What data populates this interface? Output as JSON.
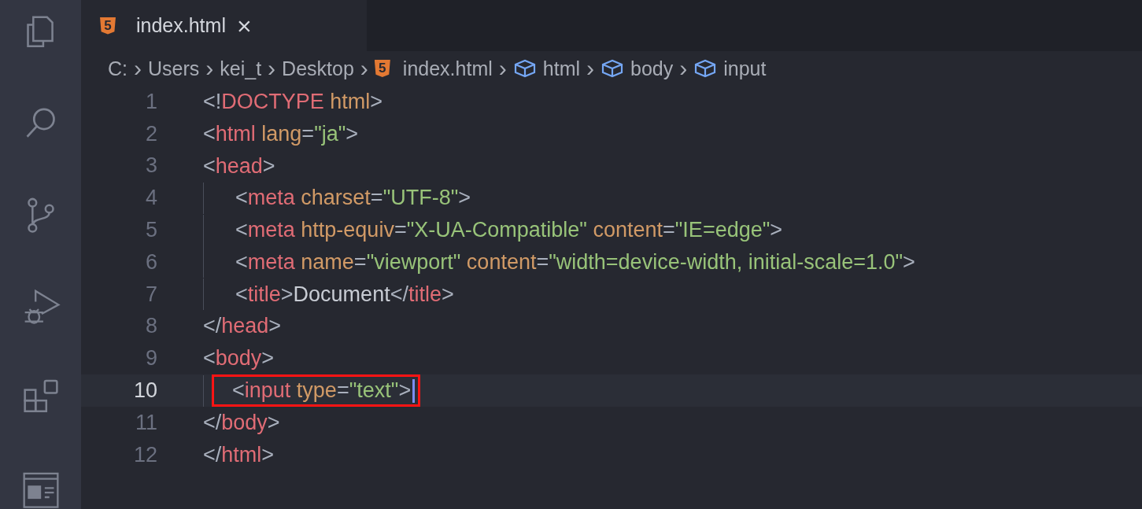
{
  "tab": {
    "icon_text": "5",
    "label": "index.html",
    "close": "×"
  },
  "breadcrumbs": [
    {
      "kind": "text",
      "label": "C:"
    },
    {
      "kind": "text",
      "label": "Users"
    },
    {
      "kind": "text",
      "label": "kei_t"
    },
    {
      "kind": "text",
      "label": "Desktop"
    },
    {
      "kind": "file",
      "icon_text": "5",
      "label": "index.html"
    },
    {
      "kind": "symbol",
      "label": "html"
    },
    {
      "kind": "symbol",
      "label": "body"
    },
    {
      "kind": "symbol",
      "label": "input"
    }
  ],
  "separator": "›",
  "lines": [
    {
      "number": "1",
      "indented": false,
      "current": false,
      "boxed": false,
      "tokens": [
        {
          "kind": "punct",
          "text": "<!"
        },
        {
          "kind": "tag",
          "text": "DOCTYPE"
        },
        {
          "kind": "attr",
          "text": " html"
        },
        {
          "kind": "punct",
          "text": ">"
        }
      ]
    },
    {
      "number": "2",
      "indented": false,
      "current": false,
      "boxed": false,
      "tokens": [
        {
          "kind": "punct",
          "text": "<"
        },
        {
          "kind": "tag",
          "text": "html"
        },
        {
          "kind": "attr",
          "text": " lang"
        },
        {
          "kind": "punct",
          "text": "="
        },
        {
          "kind": "str",
          "text": "\"ja\""
        },
        {
          "kind": "punct",
          "text": ">"
        }
      ]
    },
    {
      "number": "3",
      "indented": false,
      "current": false,
      "boxed": false,
      "tokens": [
        {
          "kind": "punct",
          "text": "<"
        },
        {
          "kind": "tag",
          "text": "head"
        },
        {
          "kind": "punct",
          "text": ">"
        }
      ]
    },
    {
      "number": "4",
      "indented": true,
      "current": false,
      "boxed": false,
      "tokens": [
        {
          "kind": "punct",
          "text": "<"
        },
        {
          "kind": "tag",
          "text": "meta"
        },
        {
          "kind": "attr",
          "text": " charset"
        },
        {
          "kind": "punct",
          "text": "="
        },
        {
          "kind": "str",
          "text": "\"UTF-8\""
        },
        {
          "kind": "punct",
          "text": ">"
        }
      ]
    },
    {
      "number": "5",
      "indented": true,
      "current": false,
      "boxed": false,
      "tokens": [
        {
          "kind": "punct",
          "text": "<"
        },
        {
          "kind": "tag",
          "text": "meta"
        },
        {
          "kind": "attr",
          "text": " http-equiv"
        },
        {
          "kind": "punct",
          "text": "="
        },
        {
          "kind": "str",
          "text": "\"X-UA-Compatible\""
        },
        {
          "kind": "attr",
          "text": " content"
        },
        {
          "kind": "punct",
          "text": "="
        },
        {
          "kind": "str",
          "text": "\"IE=edge\""
        },
        {
          "kind": "punct",
          "text": ">"
        }
      ]
    },
    {
      "number": "6",
      "indented": true,
      "current": false,
      "boxed": false,
      "tokens": [
        {
          "kind": "punct",
          "text": "<"
        },
        {
          "kind": "tag",
          "text": "meta"
        },
        {
          "kind": "attr",
          "text": " name"
        },
        {
          "kind": "punct",
          "text": "="
        },
        {
          "kind": "str",
          "text": "\"viewport\""
        },
        {
          "kind": "attr",
          "text": " content"
        },
        {
          "kind": "punct",
          "text": "="
        },
        {
          "kind": "str",
          "text": "\"width=device-width, initial-scale=1.0\""
        },
        {
          "kind": "punct",
          "text": ">"
        }
      ]
    },
    {
      "number": "7",
      "indented": true,
      "current": false,
      "boxed": false,
      "tokens": [
        {
          "kind": "punct",
          "text": "<"
        },
        {
          "kind": "tag",
          "text": "title"
        },
        {
          "kind": "punct",
          "text": ">"
        },
        {
          "kind": "text",
          "text": "Document"
        },
        {
          "kind": "punct",
          "text": "</"
        },
        {
          "kind": "tag",
          "text": "title"
        },
        {
          "kind": "punct",
          "text": ">"
        }
      ]
    },
    {
      "number": "8",
      "indented": false,
      "current": false,
      "boxed": false,
      "tokens": [
        {
          "kind": "punct",
          "text": "</"
        },
        {
          "kind": "tag",
          "text": "head"
        },
        {
          "kind": "punct",
          "text": ">"
        }
      ]
    },
    {
      "number": "9",
      "indented": false,
      "current": false,
      "boxed": false,
      "tokens": [
        {
          "kind": "punct",
          "text": "<"
        },
        {
          "kind": "tag",
          "text": "body"
        },
        {
          "kind": "punct",
          "text": ">"
        }
      ]
    },
    {
      "number": "10",
      "indented": true,
      "current": true,
      "boxed": true,
      "tokens": [
        {
          "kind": "punct",
          "text": "<"
        },
        {
          "kind": "tag",
          "text": "input"
        },
        {
          "kind": "attr",
          "text": " type"
        },
        {
          "kind": "punct",
          "text": "="
        },
        {
          "kind": "str",
          "text": "\"text\""
        },
        {
          "kind": "punct",
          "text": ">"
        }
      ]
    },
    {
      "number": "11",
      "indented": false,
      "current": false,
      "boxed": false,
      "tokens": [
        {
          "kind": "punct",
          "text": "</"
        },
        {
          "kind": "tag",
          "text": "body"
        },
        {
          "kind": "punct",
          "text": ">"
        }
      ]
    },
    {
      "number": "12",
      "indented": false,
      "current": false,
      "boxed": false,
      "tokens": [
        {
          "kind": "punct",
          "text": "</"
        },
        {
          "kind": "tag",
          "text": "html"
        },
        {
          "kind": "punct",
          "text": ">"
        }
      ]
    }
  ]
}
